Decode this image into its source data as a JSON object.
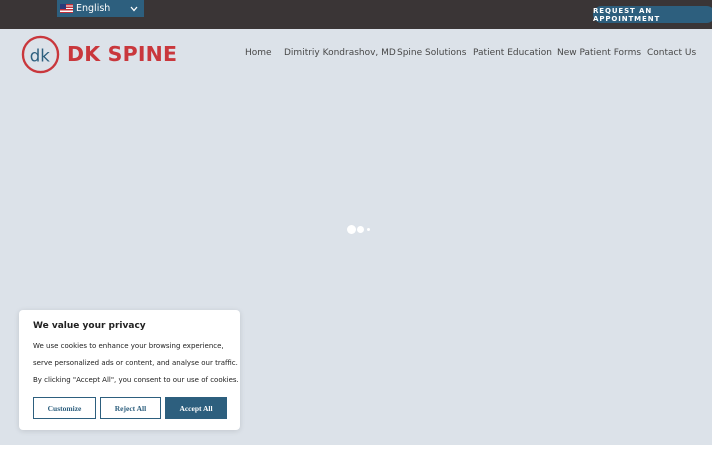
{
  "topbar": {
    "language": {
      "label": "English",
      "flag": "us-flag-icon"
    },
    "request_button": "REQUEST AN APPOINTMENT"
  },
  "header": {
    "logo_text": "DK SPINE",
    "logo_monogram": "dk",
    "nav": [
      {
        "label": "Home"
      },
      {
        "label": "Dimitriy Kondrashov, MD"
      },
      {
        "label": "Spine Solutions"
      },
      {
        "label": "Patient Education"
      },
      {
        "label": "New Patient Forms"
      },
      {
        "label": "Contact Us"
      }
    ]
  },
  "hero": {
    "loader_icon": "loading-dots-icon"
  },
  "cookie_banner": {
    "title": "We value your privacy",
    "lines": [
      "We use cookies to enhance your browsing experience,",
      "serve personalized ads or content, and analyse our traffic.",
      "By clicking \"Accept All\", you consent to our use of cookies."
    ],
    "customize": "Customize",
    "reject": "Reject All",
    "accept": "Accept All"
  },
  "colors": {
    "topbar": "#3a3536",
    "accent_blue": "#2d5f7e",
    "brand_red": "#c9373c",
    "hero_bg": "#dce2e9"
  }
}
